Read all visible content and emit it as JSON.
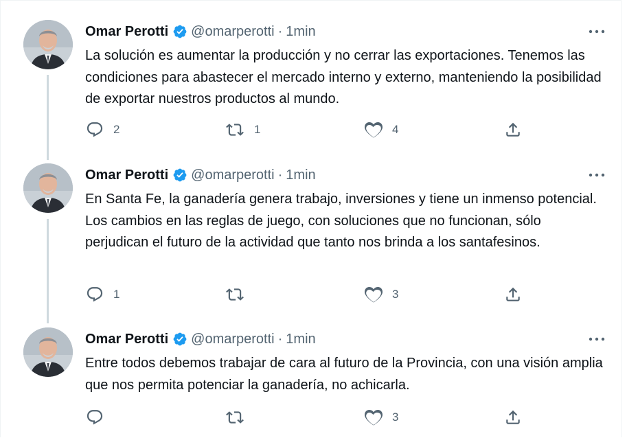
{
  "author": {
    "name": "Omar Perotti",
    "handle": "@omarperotti",
    "separator": "·",
    "verified_color": "#1d9bf0"
  },
  "tweets": [
    {
      "time": "1min",
      "text": "La solución es aumentar la producción y no cerrar las exportaciones. Tenemos las condiciones para abastecer el mercado interno y externo, manteniendo la posibilidad de exportar nuestros productos al mundo.",
      "replies": "2",
      "retweets": "1",
      "likes": "4"
    },
    {
      "time": "1min",
      "text": "En Santa Fe, la ganadería genera trabajo, inversiones y tiene un inmenso potencial. Los cambios en las reglas de juego, con soluciones que no funcionan, sólo perjudican el futuro de la actividad que tanto nos brinda a los santafesinos.",
      "replies": "1",
      "retweets": "",
      "likes": "3"
    },
    {
      "time": "1min",
      "text": "Entre todos debemos trabajar de cara al futuro de la Provincia, con una visión amplia que nos permita potenciar la ganadería, no achicarla.",
      "replies": "",
      "retweets": "",
      "likes": "3"
    }
  ],
  "icons": {
    "reply": "reply-icon",
    "retweet": "retweet-icon",
    "like": "heart-icon",
    "share": "share-icon",
    "more": "more-icon"
  }
}
